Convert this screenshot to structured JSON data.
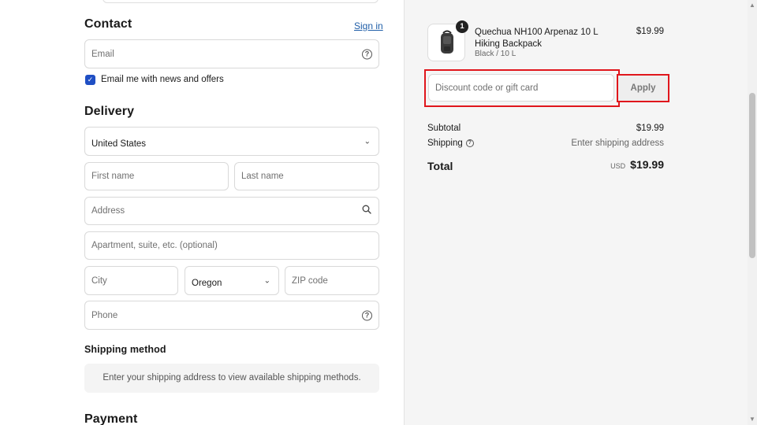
{
  "contact": {
    "title": "Contact",
    "sign_in": "Sign in",
    "email_placeholder": "Email",
    "newsletter_label": "Email me with news and offers",
    "newsletter_checked": true
  },
  "delivery": {
    "title": "Delivery",
    "country": "United States",
    "first_name_placeholder": "First name",
    "last_name_placeholder": "Last name",
    "address_placeholder": "Address",
    "apartment_placeholder": "Apartment, suite, etc. (optional)",
    "city_placeholder": "City",
    "state": "Oregon",
    "zip_placeholder": "ZIP code",
    "phone_placeholder": "Phone"
  },
  "shipping_method": {
    "title": "Shipping method",
    "notice": "Enter your shipping address to view available shipping methods."
  },
  "payment": {
    "title": "Payment"
  },
  "order": {
    "item": {
      "quantity": "1",
      "name": "Quechua NH100 Arpenaz 10 L Hiking Backpack",
      "variant": "Black / 10 L",
      "price": "$19.99"
    },
    "discount_placeholder": "Discount code or gift card",
    "apply_label": "Apply",
    "subtotal_label": "Subtotal",
    "subtotal_value": "$19.99",
    "shipping_label": "Shipping",
    "shipping_value": "Enter shipping address",
    "total_label": "Total",
    "currency": "USD",
    "total_value": "$19.99"
  },
  "colors": {
    "accent": "#1f4fc4",
    "link": "#1f5ea8",
    "highlight": "#e0161c"
  },
  "icons": [
    "help-icon",
    "chevron-down-icon",
    "search-icon",
    "check-icon",
    "info-icon",
    "backpack-image"
  ]
}
